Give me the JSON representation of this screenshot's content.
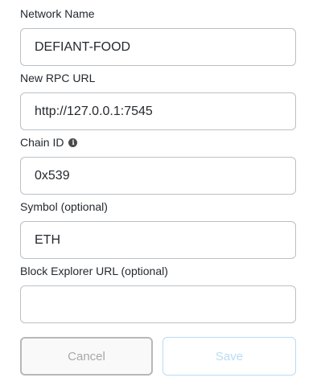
{
  "fields": [
    {
      "label": "Network Name",
      "value": "DEFIANT-FOOD",
      "placeholder": ""
    },
    {
      "label": "New RPC URL",
      "value": "http://127.0.0.1:7545",
      "placeholder": ""
    },
    {
      "label": "Chain ID",
      "value": "0x539",
      "placeholder": "",
      "info_icon": "info-icon"
    },
    {
      "label": "Symbol (optional)",
      "value": "ETH",
      "placeholder": ""
    },
    {
      "label": "Block Explorer URL (optional)",
      "value": "",
      "placeholder": ""
    }
  ],
  "buttons": {
    "cancel_label": "Cancel",
    "save_label": "Save"
  },
  "info_icon_glyph": "i",
  "colors": {
    "text": "#24292e",
    "border": "#bbc0c5",
    "save_disabled": "#b8dcf5",
    "cancel_disabled": "#a8a8a8"
  }
}
